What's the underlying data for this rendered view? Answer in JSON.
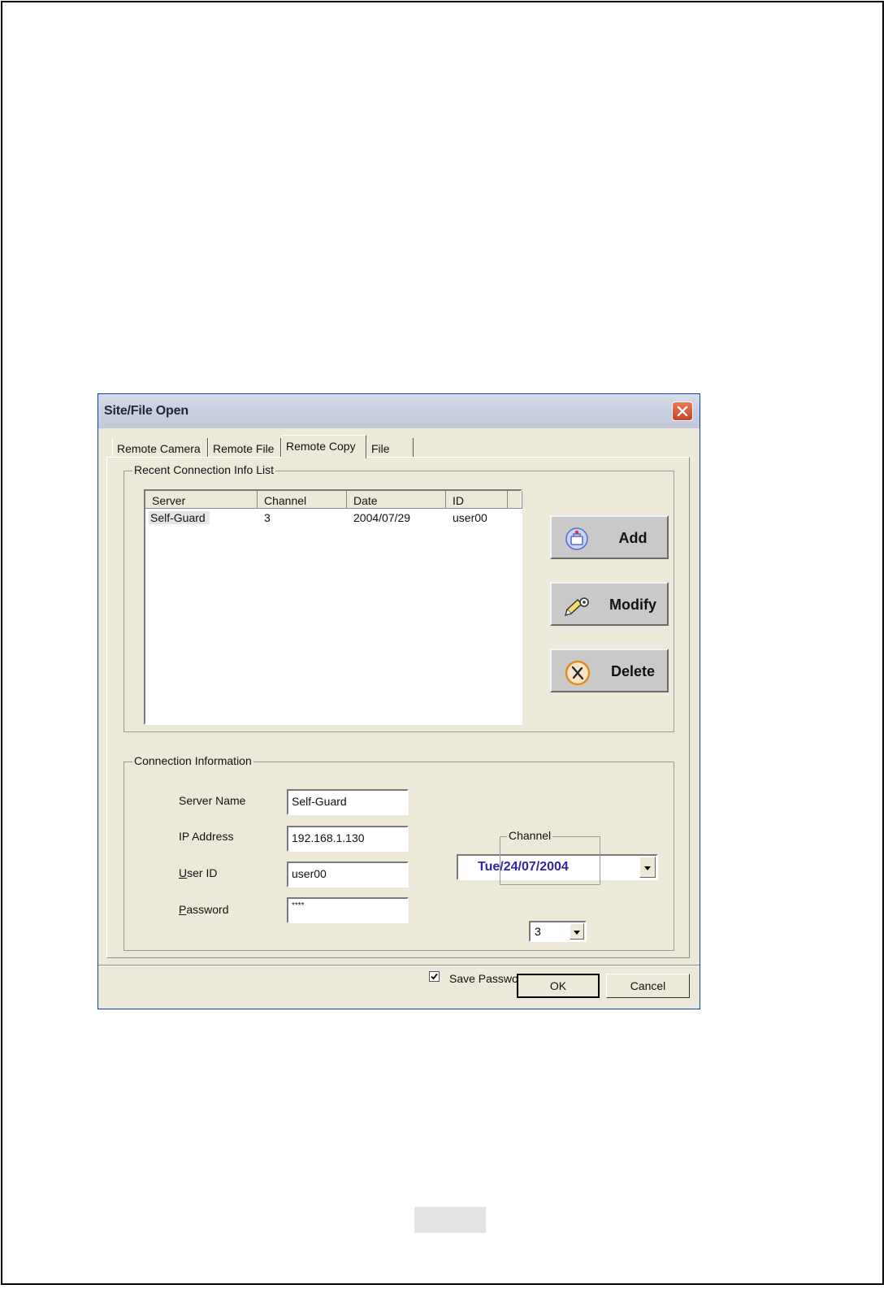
{
  "dialog": {
    "title": "Site/File Open",
    "tabs": [
      {
        "label": "Remote Camera"
      },
      {
        "label": "Remote File"
      },
      {
        "label": "Remote Copy",
        "active": true
      },
      {
        "label": "File"
      }
    ],
    "recent_group": {
      "label": "Recent Connection Info List",
      "columns": [
        "Server",
        "Channel",
        "Date",
        "ID"
      ],
      "rows": [
        {
          "server": "Self-Guard",
          "channel": "3",
          "date": "2004/07/29",
          "id": "user00"
        }
      ]
    },
    "buttons": {
      "add": "Add",
      "modify": "Modify",
      "delete": "Delete",
      "ok": "OK",
      "cancel": "Cancel"
    },
    "connection_group": {
      "label": "Connection Information",
      "server_name_label": "Server Name",
      "server_name_value": "Self-Guard",
      "ip_label": "IP Address",
      "ip_value": "192.168.1.130",
      "user_id_label_prefix": "U",
      "user_id_label_rest": "ser ID",
      "user_id_value": "user00",
      "password_label_prefix": "P",
      "password_label_rest": "assword",
      "password_value": "****",
      "date_value": "Tue/24/07/2004",
      "channel_group_label": "Channel",
      "channel_value": "3",
      "save_password_label": "Save Password",
      "save_password_checked": true
    }
  },
  "colors": {
    "dialog_bg": "#ece9d8",
    "date_text": "#2a2aa8",
    "close_button": "#d8583c"
  },
  "icons": [
    "close-icon",
    "add-icon",
    "modify-icon",
    "delete-icon",
    "chevron-down-icon",
    "check-icon"
  ]
}
